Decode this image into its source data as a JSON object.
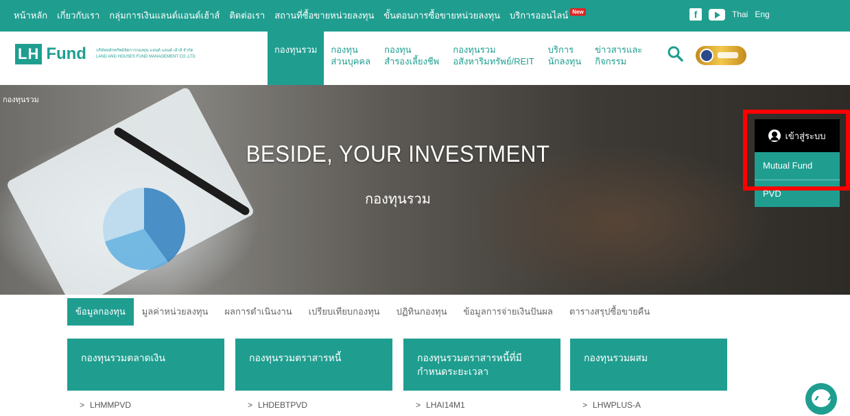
{
  "topbar": {
    "links": [
      "หน้าหลัก",
      "เกี่ยวกับเรา",
      "กลุ่มการเงินแลนด์แอนด์เฮ้าส์",
      "ติดต่อเรา",
      "สถานที่ซื้อขายหน่วยลงทุน",
      "ขั้นตอนการซื้อขายหน่วยลงทุน",
      "บริการออนไลน์"
    ],
    "new_badge": "New",
    "languages": [
      "Thai",
      "Eng"
    ]
  },
  "header": {
    "logo_lh": "LH",
    "logo_fund": "Fund",
    "company_th": "บริษัทหลักทรัพย์จัดการกองทุน แลนด์ แอนด์ เฮ้าส์ จำกัด",
    "company_en": "LAND AND HOUSES FUND MANAGEMENT CO.,LTD",
    "nav": [
      {
        "line1": "กองทุนรวม",
        "line2": ""
      },
      {
        "line1": "กองทุน",
        "line2": "ส่วนบุคคล"
      },
      {
        "line1": "กองทุน",
        "line2": "สำรองเลี้ยงชีพ"
      },
      {
        "line1": "กองทุนรวม",
        "line2": "อสังหาริมทรัพย์/REIT"
      },
      {
        "line1": "บริการ",
        "line2": "นักลงทุน"
      },
      {
        "line1": "ข่าวสารและ",
        "line2": "กิจกรรม"
      }
    ]
  },
  "hero": {
    "breadcrumb": "กองทุนรวม",
    "tagline": "BESIDE, YOUR INVESTMENT",
    "subtitle": "กองทุนรวม"
  },
  "login": {
    "title": "เข้าสู่ระบบ",
    "options": [
      "Mutual Fund",
      "PVD"
    ]
  },
  "tabs": [
    "ข้อมูลกองทุน",
    "มูลค่าหน่วยลงทุน",
    "ผลการดำเนินงาน",
    "เปรียบเทียบกองทุน",
    "ปฏิทินกองทุน",
    "ข้อมูลการจ่ายเงินปันผล",
    "ตารางสรุปซื้อขายคืน"
  ],
  "cards": [
    {
      "title": "กองทุนรวมตลาดเงิน",
      "item": "LHMMPVD"
    },
    {
      "title": "กองทุนรวมตราสารหนี้",
      "item": "LHDEBTPVD"
    },
    {
      "title": "กองทุนรวมตราสารหนี้ที่มีกำหนดระยะเวลา",
      "item": "LHAI14M1"
    },
    {
      "title": "กองทุนรวมผสม",
      "item": "LHWPLUS-A"
    }
  ],
  "colors": {
    "brand": "#1f9e90",
    "highlight": "#ff0000",
    "login_head": "#000000"
  },
  "icons": [
    "facebook-icon",
    "youtube-icon",
    "search-icon",
    "user-icon",
    "chevron-right-icon",
    "messenger-icon"
  ]
}
